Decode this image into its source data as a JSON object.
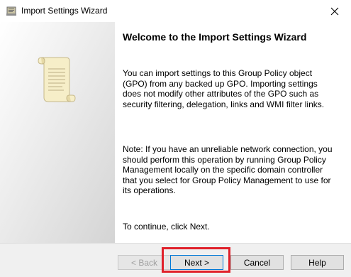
{
  "window": {
    "title": "Import Settings Wizard",
    "icon": "wizard-app-icon",
    "close_glyph": "✕"
  },
  "side_panel": {
    "icon": "scroll-icon"
  },
  "content": {
    "heading": "Welcome to the Import Settings Wizard",
    "paragraph1": "You can import settings to this Group Policy object (GPO) from any backed up GPO. Importing settings does not modify other attributes of the GPO such as security filtering, delegation, links and WMI filter links.",
    "paragraph2": "Note: If you have an unreliable network connection, you should perform this operation by running Group Policy Management locally on the specific domain controller that you select for Group Policy Management to use for its operations.",
    "paragraph3": "To continue, click Next."
  },
  "buttons": {
    "back": "< Back",
    "next": "Next >",
    "cancel": "Cancel",
    "help": "Help"
  },
  "colors": {
    "highlight": "#e0202a",
    "focus_border": "#0078d7"
  }
}
